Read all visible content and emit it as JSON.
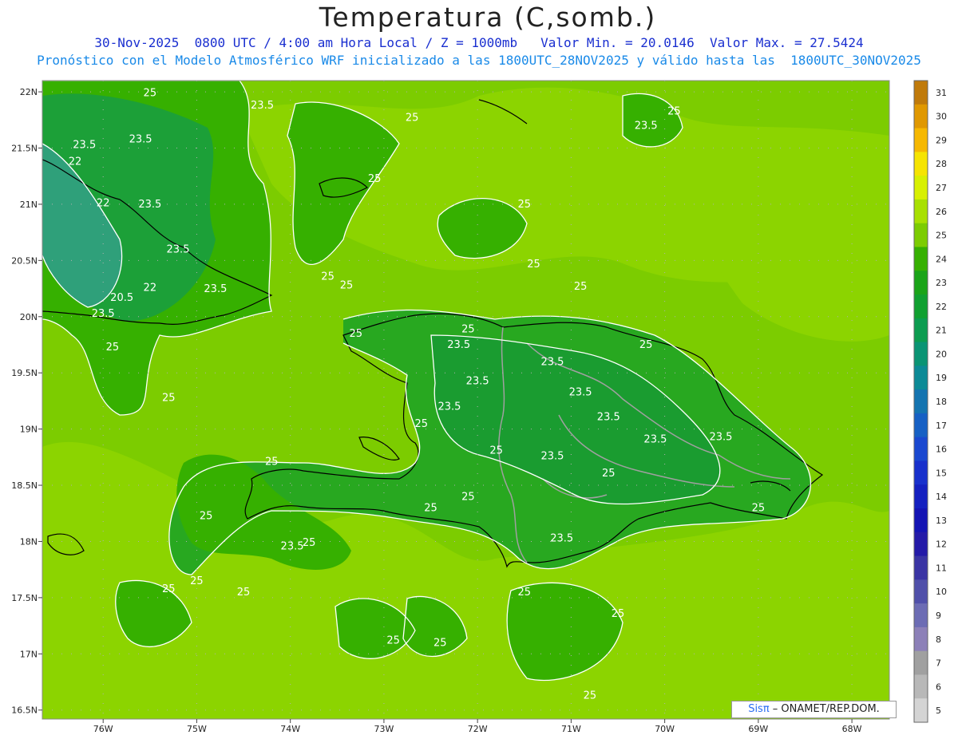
{
  "header": {
    "title": "Temperatura (C,somb.)",
    "line1": "30-Nov-2025  0800 UTC / 4:00 am Hora Local / Z = 1000mb   Valor Min. = 20.0146  Valor Max. = 27.5424",
    "line2": "Pronóstico con el Modelo Atmosférico WRF inicializado a las 1800UTC_28NOV2025 y válido hasta las  1800UTC_30NOV2025"
  },
  "map": {
    "lat_labels": [
      "22N",
      "21.5N",
      "21N",
      "20.5N",
      "20N",
      "19.5N",
      "19N",
      "18.5N",
      "18N",
      "17.5N",
      "17N",
      "16.5N"
    ],
    "lon_labels": [
      "76W",
      "75W",
      "74W",
      "73W",
      "72W",
      "71W",
      "70W",
      "69W",
      "68W"
    ],
    "contour_labels": [
      {
        "text": "25",
        "lon": -75.5,
        "lat": 21.96
      },
      {
        "text": "23.5",
        "lon": -74.3,
        "lat": 21.85
      },
      {
        "text": "25",
        "lon": -72.7,
        "lat": 21.74
      },
      {
        "text": "23.5",
        "lon": -76.2,
        "lat": 21.5
      },
      {
        "text": "23.5",
        "lon": -75.6,
        "lat": 21.55
      },
      {
        "text": "22",
        "lon": -76.3,
        "lat": 21.35
      },
      {
        "text": "23.5",
        "lon": -70.2,
        "lat": 21.67
      },
      {
        "text": "25",
        "lon": -69.9,
        "lat": 21.8
      },
      {
        "text": "25",
        "lon": -73.1,
        "lat": 21.2
      },
      {
        "text": "22",
        "lon": -76.0,
        "lat": 20.98
      },
      {
        "text": "23.5",
        "lon": -75.5,
        "lat": 20.97
      },
      {
        "text": "25",
        "lon": -71.5,
        "lat": 20.97
      },
      {
        "text": "23.5",
        "lon": -75.2,
        "lat": 20.57
      },
      {
        "text": "25",
        "lon": -71.4,
        "lat": 20.44
      },
      {
        "text": "25",
        "lon": -73.6,
        "lat": 20.33
      },
      {
        "text": "25",
        "lon": -73.4,
        "lat": 20.25
      },
      {
        "text": "22",
        "lon": -75.5,
        "lat": 20.23
      },
      {
        "text": "23.5",
        "lon": -74.8,
        "lat": 20.22
      },
      {
        "text": "20.5",
        "lon": -75.8,
        "lat": 20.14
      },
      {
        "text": "23.5",
        "lon": -76.0,
        "lat": 20.0
      },
      {
        "text": "25",
        "lon": -70.9,
        "lat": 20.24
      },
      {
        "text": "25",
        "lon": -72.1,
        "lat": 19.86
      },
      {
        "text": "25",
        "lon": -73.3,
        "lat": 19.82
      },
      {
        "text": "23.5",
        "lon": -72.2,
        "lat": 19.72
      },
      {
        "text": "25",
        "lon": -70.2,
        "lat": 19.72
      },
      {
        "text": "25",
        "lon": -75.9,
        "lat": 19.7
      },
      {
        "text": "23.5",
        "lon": -71.2,
        "lat": 19.57
      },
      {
        "text": "23.5",
        "lon": -72.0,
        "lat": 19.4
      },
      {
        "text": "23.5",
        "lon": -70.9,
        "lat": 19.3
      },
      {
        "text": "25",
        "lon": -75.3,
        "lat": 19.25
      },
      {
        "text": "23.5",
        "lon": -72.3,
        "lat": 19.17
      },
      {
        "text": "23.5",
        "lon": -70.6,
        "lat": 19.08
      },
      {
        "text": "25",
        "lon": -72.6,
        "lat": 19.02
      },
      {
        "text": "23.5",
        "lon": -69.4,
        "lat": 18.9
      },
      {
        "text": "23.5",
        "lon": -70.1,
        "lat": 18.88
      },
      {
        "text": "25",
        "lon": -71.8,
        "lat": 18.78
      },
      {
        "text": "23.5",
        "lon": -71.2,
        "lat": 18.73
      },
      {
        "text": "25",
        "lon": -74.2,
        "lat": 18.68
      },
      {
        "text": "25",
        "lon": -70.6,
        "lat": 18.58
      },
      {
        "text": "25",
        "lon": -72.1,
        "lat": 18.37
      },
      {
        "text": "25",
        "lon": -72.5,
        "lat": 18.27
      },
      {
        "text": "25",
        "lon": -69.0,
        "lat": 18.27
      },
      {
        "text": "25",
        "lon": -74.9,
        "lat": 18.2
      },
      {
        "text": "23.5",
        "lon": -71.1,
        "lat": 18.0
      },
      {
        "text": "25",
        "lon": -73.8,
        "lat": 17.96
      },
      {
        "text": "23.5",
        "lon": -73.98,
        "lat": 17.93
      },
      {
        "text": "25",
        "lon": -75.0,
        "lat": 17.62
      },
      {
        "text": "25",
        "lon": -75.3,
        "lat": 17.55
      },
      {
        "text": "25",
        "lon": -71.5,
        "lat": 17.52
      },
      {
        "text": "25",
        "lon": -74.5,
        "lat": 17.52
      },
      {
        "text": "25",
        "lon": -70.5,
        "lat": 17.33
      },
      {
        "text": "25",
        "lon": -72.9,
        "lat": 17.09
      },
      {
        "text": "25",
        "lon": -72.4,
        "lat": 17.07
      },
      {
        "text": "25",
        "lon": -70.8,
        "lat": 16.6
      }
    ]
  },
  "colorbar": {
    "labels": [
      "31",
      "30",
      "29",
      "28",
      "27",
      "26",
      "25",
      "24",
      "23",
      "22",
      "21",
      "20",
      "19",
      "18",
      "17",
      "16",
      "15",
      "14",
      "13",
      "12",
      "11",
      "10",
      "9",
      "8",
      "7",
      "6",
      "5"
    ],
    "colors": [
      "#c07a0a",
      "#e09800",
      "#f6b800",
      "#f6e400",
      "#d8f000",
      "#a8e000",
      "#7ccc00",
      "#36b000",
      "#1aa418",
      "#10a030",
      "#0c9c50",
      "#0a9474",
      "#0c8a96",
      "#1474b0",
      "#1660c4",
      "#1a48d0",
      "#1830cc",
      "#1420c0",
      "#1414b4",
      "#241aa8",
      "#3a34a4",
      "#5050aa",
      "#6c6cb4",
      "#8c80b8",
      "#a0a0a0",
      "#b8b8b8",
      "#d4d4d4"
    ]
  },
  "credit": {
    "brand": "Sisπ",
    "rest": " – ONAMET/REP.DOM."
  },
  "colors": {
    "ocean_warm": "#8fd400",
    "ocean_mid": "#6cc400",
    "land_cool": "#30a020",
    "land_cooler": "#1c9030",
    "cold_core": "#3fa888",
    "contour": "#ffffff",
    "coast": "#000000",
    "border": "#a0a0a0"
  }
}
